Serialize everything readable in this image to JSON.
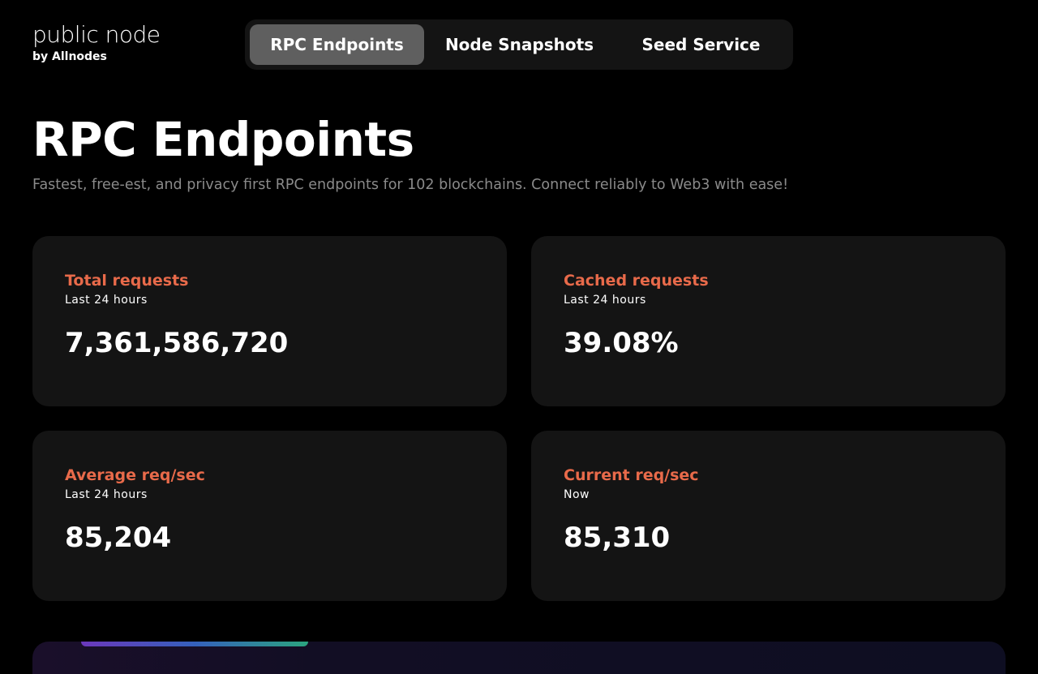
{
  "logo": {
    "name": "public node",
    "tagline": "by Allnodes"
  },
  "nav": {
    "tabs": [
      {
        "label": "RPC Endpoints",
        "active": true
      },
      {
        "label": "Node Snapshots",
        "active": false
      },
      {
        "label": "Seed Service",
        "active": false
      }
    ]
  },
  "page": {
    "title": "RPC Endpoints",
    "subtitle": "Fastest, free-est, and privacy first RPC endpoints for 102 blockchains. Connect reliably to Web3 with ease!"
  },
  "stats": [
    {
      "title": "Total requests",
      "period": "Last 24 hours",
      "value": "7,361,586,720"
    },
    {
      "title": "Cached requests",
      "period": "Last 24 hours",
      "value": "39.08%"
    },
    {
      "title": "Average req/sec",
      "period": "Last 24 hours",
      "value": "85,204"
    },
    {
      "title": "Current req/sec",
      "period": "Now",
      "value": "85,310"
    }
  ],
  "colors": {
    "accent": "#e86a4a",
    "background": "#000000",
    "card": "#141414",
    "active_tab": "#5f5f5f"
  }
}
